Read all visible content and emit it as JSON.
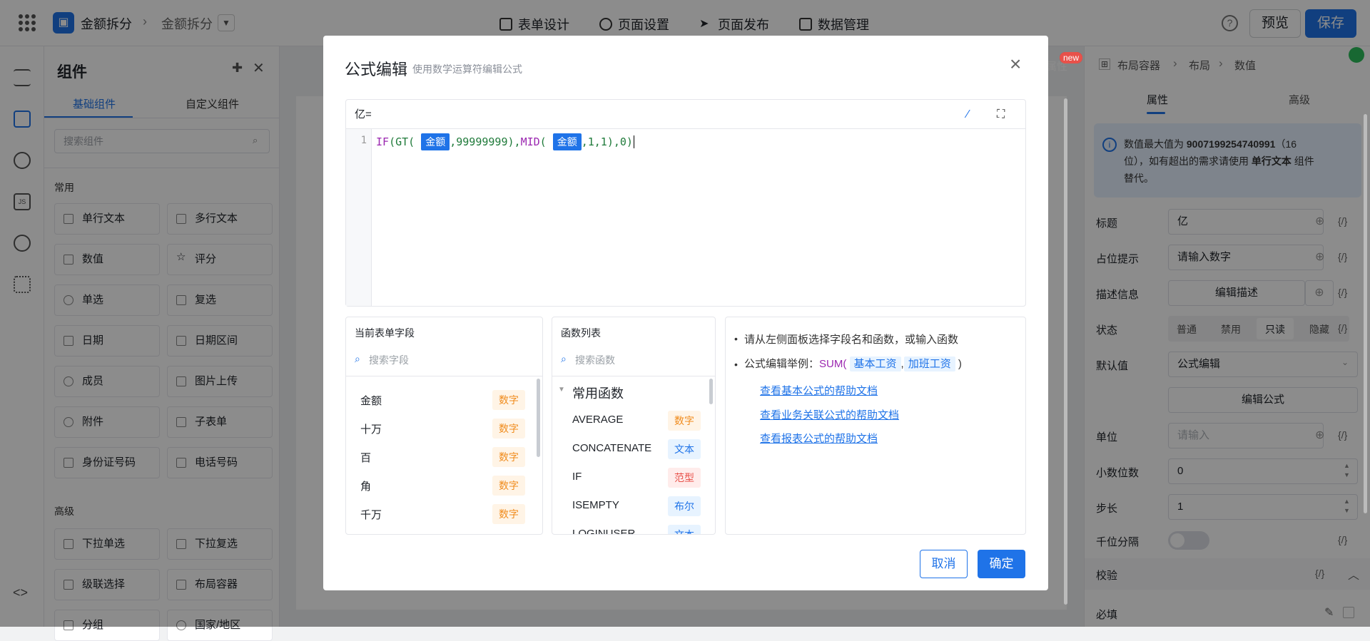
{
  "topbar": {
    "crumb1": "金额拆分",
    "crumb2": "金额拆分",
    "tabs": [
      "表单设计",
      "页面设置",
      "页面发布",
      "数据管理"
    ],
    "preview_label": "预览",
    "save_label": "保存",
    "help": "?"
  },
  "components": {
    "title": "组件",
    "tabs": [
      "基础组件",
      "自定义组件"
    ],
    "search_placeholder": "搜索组件",
    "section_common": "常用",
    "section_advanced": "高级",
    "items": [
      "单行文本",
      "多行文本",
      "数值",
      "评分",
      "单选",
      "复选",
      "日期",
      "日期区间",
      "成员",
      "图片上传",
      "附件",
      "子表单",
      "身份证号码",
      "电话号码"
    ],
    "advanced_items": [
      "下拉单选",
      "下拉复选",
      "级联选择",
      "布局容器",
      "分组",
      "国家/地区"
    ]
  },
  "right": {
    "attr_tab": "属性",
    "adv_tab": "高级",
    "new_badge": "new",
    "path": [
      "布局容器",
      "布局",
      "数值"
    ],
    "info": {
      "line1a": "数值最大值为",
      "max": "9007199254740991",
      "line1b": "（16",
      "line2a": "位），如有超出的需求请使用",
      "line2b": "单行文本",
      "line2c": "组件",
      "line3": "替代。"
    },
    "fields": {
      "title_label": "标题",
      "title_value": "亿",
      "placeholder_label": "占位提示",
      "placeholder_value": "请输入数字",
      "desc_label": "描述信息",
      "desc_btn": "编辑描述",
      "state_label": "状态",
      "states": [
        "普通",
        "禁用",
        "只读",
        "隐藏"
      ],
      "default_label": "默认值",
      "default_value": "公式编辑",
      "edit_formula": "编辑公式",
      "unit_label": "单位",
      "unit_placeholder": "请输入",
      "decimal_label": "小数位数",
      "decimal_value": "0",
      "step_label": "步长",
      "step_value": "1",
      "thousands_label": "千位分隔",
      "validate_label": "校验",
      "required_label": "必填",
      "brace": "{/}"
    }
  },
  "modal": {
    "title": "公式编辑",
    "subtitle": "使用数学运算符编辑公式",
    "formula_prefix": "亿=",
    "line_no": "1",
    "code": {
      "p1": "IF",
      "p2": "(",
      "p3": "GT",
      "p4": "(",
      "tok1": "金额",
      "p5": ",99999999),",
      "p6": "MID",
      "p7": "(",
      "tok2": "金额",
      "p8": ",1,1),0)"
    },
    "fields_panel": {
      "title": "当前表单字段",
      "search": "搜索字段",
      "rows": [
        {
          "name": "金额",
          "type": "数字"
        },
        {
          "name": "十万",
          "type": "数字"
        },
        {
          "name": "百",
          "type": "数字"
        },
        {
          "name": "角",
          "type": "数字"
        },
        {
          "name": "千万",
          "type": "数字"
        }
      ]
    },
    "func_panel": {
      "title": "函数列表",
      "search": "搜索函数",
      "group": "常用函数",
      "rows": [
        {
          "name": "AVERAGE",
          "type": "数字"
        },
        {
          "name": "CONCATENATE",
          "type": "文本"
        },
        {
          "name": "IF",
          "type": "范型"
        },
        {
          "name": "ISEMPTY",
          "type": "布尔"
        },
        {
          "name": "LOGINUSER",
          "type": "文本"
        }
      ]
    },
    "help": {
      "line1": "请从左侧面板选择字段名和函数，或输入函数",
      "line2_prefix": "公式编辑举例：",
      "line2_fn": "SUM(",
      "chip1": "基本工资",
      "sep": ",",
      "chip2": "加班工资",
      "line2_end": ")",
      "links": [
        "查看基本公式的帮助文档",
        "查看业务关联公式的帮助文档",
        "查看报表公式的帮助文档"
      ]
    },
    "cancel_label": "取消",
    "ok_label": "确定"
  }
}
